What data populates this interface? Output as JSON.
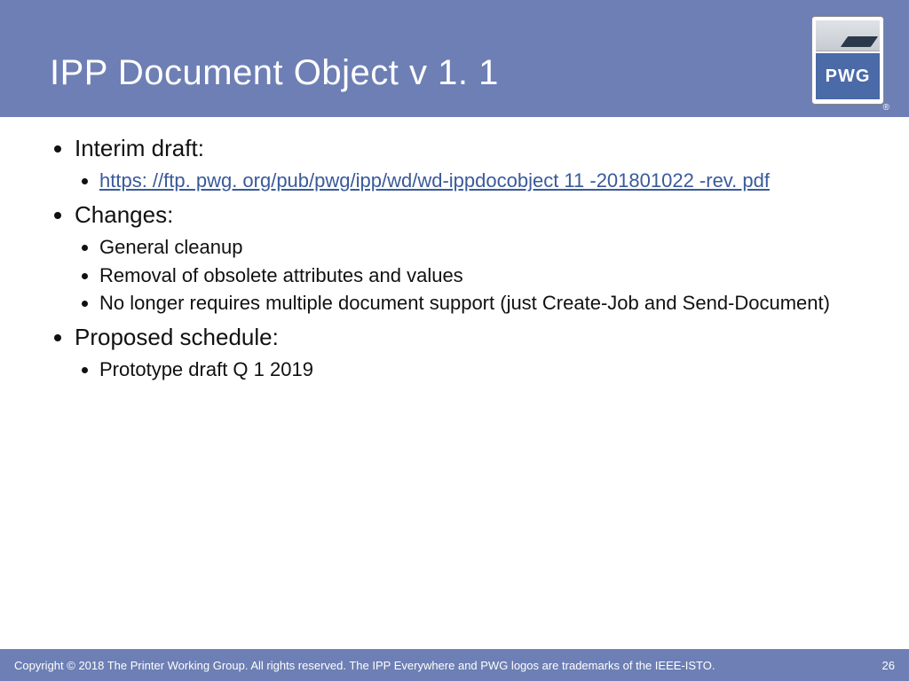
{
  "header": {
    "title": "IPP Document Object v 1. 1",
    "logo_text": "PWG",
    "registered": "®"
  },
  "content": {
    "sections": [
      {
        "label": "Interim draft:",
        "items": [
          {
            "text": "https: //ftp. pwg. org/pub/pwg/ipp/wd/wd-ippdocobject 11 -201801022 -rev. pdf",
            "link": true
          }
        ]
      },
      {
        "label": "Changes:",
        "items": [
          {
            "text": "General cleanup"
          },
          {
            "text": "Removal of obsolete attributes and values"
          },
          {
            "text": "No longer requires multiple document support (just Create-Job and Send-Document)"
          }
        ]
      },
      {
        "label": "Proposed schedule:",
        "items": [
          {
            "text": "Prototype draft Q 1 2019"
          }
        ]
      }
    ]
  },
  "footer": {
    "copyright": "Copyright © 2018 The Printer Working Group. All rights reserved. The IPP Everywhere and PWG logos are trademarks of the IEEE-ISTO.",
    "page": "26"
  }
}
